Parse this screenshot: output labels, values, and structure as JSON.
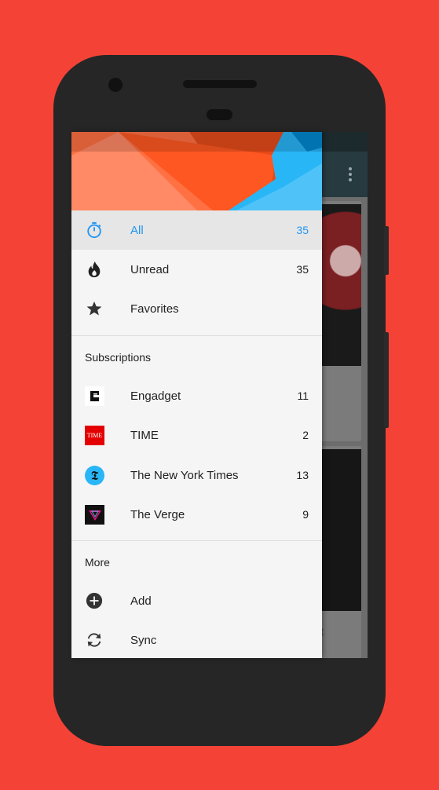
{
  "colors": {
    "background": "#F44336",
    "accent": "#2196F3",
    "active_row": "#e6e6e6"
  },
  "nav": [
    {
      "icon": "timer-icon",
      "label": "All",
      "count": "35",
      "active": true
    },
    {
      "icon": "flame-icon",
      "label": "Unread",
      "count": "35",
      "active": false
    },
    {
      "icon": "star-icon",
      "label": "Favorites",
      "count": "",
      "active": false
    }
  ],
  "subscriptions": {
    "title": "Subscriptions",
    "items": [
      {
        "icon": "engadget-icon",
        "label": "Engadget",
        "count": "11"
      },
      {
        "icon": "time-icon",
        "icon_text": "TIME",
        "label": "TIME",
        "count": "2"
      },
      {
        "icon": "nyt-icon",
        "icon_text": "𝕿",
        "label": "The New York Times",
        "count": "13"
      },
      {
        "icon": "verge-icon",
        "label": "The Verge",
        "count": "9"
      }
    ]
  },
  "more": {
    "title": "More",
    "items": [
      {
        "icon": "add-icon",
        "label": "Add"
      },
      {
        "icon": "sync-icon",
        "label": "Sync"
      }
    ]
  },
  "background_app": {
    "partial_text": "t"
  }
}
